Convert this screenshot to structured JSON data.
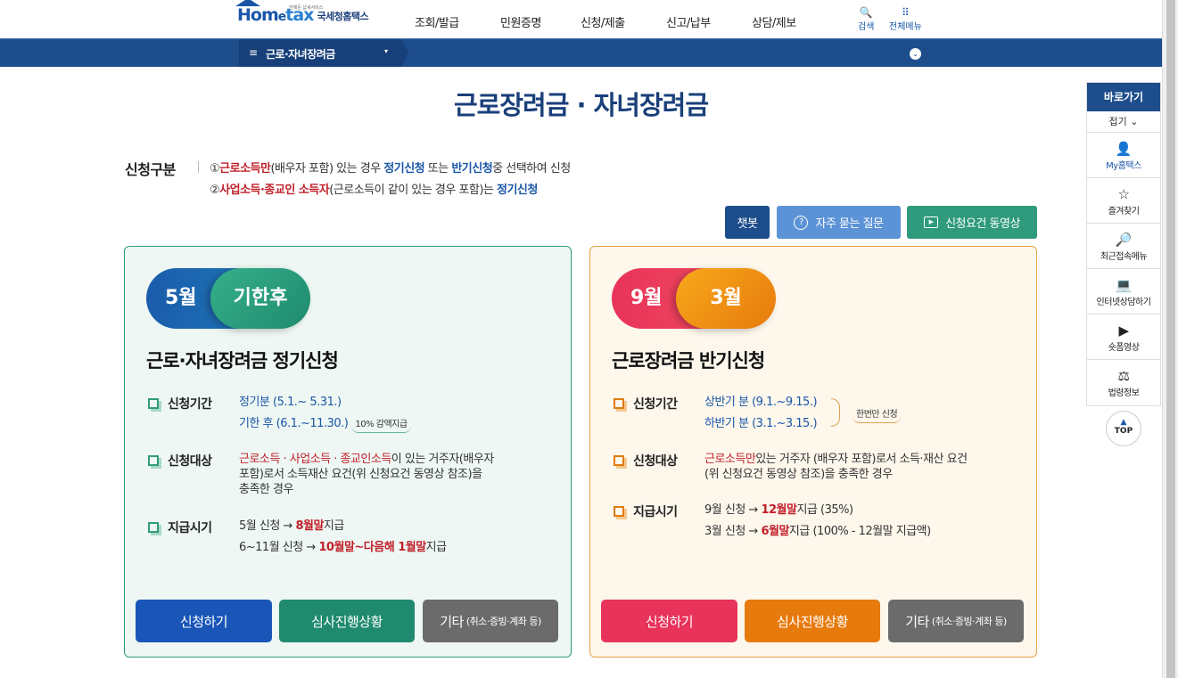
{
  "header": {
    "logo_text_home": "Hom",
    "logo_text_e": "e",
    "logo_text_tax": "tax",
    "logo_sub": "언제든 납세서비스",
    "logo_kr": "국세청홈택스",
    "gnb": [
      "조회/발급",
      "민원증명",
      "신청/제출",
      "신고/납부",
      "상담/제보"
    ],
    "search_label": "검색",
    "allmenu_label": "전체메뉴",
    "search_icon": "🔍",
    "allmenu_icon": "⠿"
  },
  "navbar": {
    "menu_icon": "≡",
    "selected": "근로·자녀장려금",
    "caret": "▾",
    "expand_icon": "⌄"
  },
  "page": {
    "title": "근로장려금 · 자녀장려금"
  },
  "apply": {
    "label": "신청구분",
    "line1": {
      "num": "①",
      "red": "근로소득만",
      "t1": "(배우자 포함) 있는 경우 ",
      "blue1": "정기신청",
      "t2": " 또는 ",
      "blue2": "반기신청",
      "t3": "중 선택하여 신청"
    },
    "line2": {
      "num": "②",
      "red": "사업소득·종교인 소득자",
      "t1": "(근로소득이 같이 있는 경우 포함)는 ",
      "blue": "정기신청"
    }
  },
  "top_buttons": {
    "chatbot": "챗봇",
    "faq": "자주 묻는 질문",
    "faq_icon": "?",
    "video": "신청요건 동영상",
    "video_icon": "▶"
  },
  "card_regular": {
    "pill_a": "5월",
    "pill_b": "기한후",
    "title": "근로·자녀장려금 정기신청",
    "period_label": "신청기간",
    "period_1": "정기분 (5.1.~ 5.31.)",
    "period_2": "기한 후 (6.1.~11.30.)",
    "period_2_note": "10% 감액지급",
    "target_label": "신청대상",
    "target_red": "근로소득 · 사업소득 · 종교인소득",
    "target_rest_1": "이 있는 거주자(배우자",
    "target_rest_2": "포함)로서 소득재산 요건(위 신청요건 동영상 참조)을",
    "target_rest_3": "충족한 경우",
    "pay_label": "지급시기",
    "pay_1_a": "5월 신청 → ",
    "pay_1_red": "8월말",
    "pay_1_b": "지급",
    "pay_2_a": "6~11월 신청 → ",
    "pay_2_red": "10월말~다음해 1월말",
    "pay_2_b": "지급",
    "btn_apply": "신청하기",
    "btn_status": "심사진행상황",
    "btn_etc": "기타",
    "btn_etc_small": "(취소·증빙·계좌 등)"
  },
  "card_half": {
    "pill_a": "9월",
    "pill_b": "3월",
    "title": "근로장려금 반기신청",
    "period_label": "신청기간",
    "period_1": "상반기 분 (9.1.~9.15.)",
    "period_2": "하반기 분 (3.1.~3.15.)",
    "period_note": "한번만 신청",
    "target_label": "신청대상",
    "target_red": "근로소득만",
    "target_rest_1": "있는 거주자 (배우자 포함)로서 소득·재산 요건",
    "target_rest_2": "(위 신청요건 동영상 참조)을 충족한 경우",
    "pay_label": "지급시기",
    "pay_1_a": "9월 신청 → ",
    "pay_1_red": "12월말",
    "pay_1_b": "지급 (35%)",
    "pay_2_a": "3월 신청 → ",
    "pay_2_red": "6월말",
    "pay_2_b": "지급 (100% - 12월말 지급액)",
    "btn_apply": "신청하기",
    "btn_status": "심사진행상황",
    "btn_etc": "기타",
    "btn_etc_small": "(취소·증빙·계좌 등)"
  },
  "quick": {
    "head": "바로가기",
    "fold": "접기 ⌄",
    "items": [
      {
        "icon": "👤",
        "label": "My홈택스"
      },
      {
        "icon": "☆",
        "label": "즐겨찾기"
      },
      {
        "icon": "🔎",
        "label": "최근접속메뉴"
      },
      {
        "icon": "💻",
        "label": "인터넷상담하기"
      },
      {
        "icon": "▶",
        "label": "숏폼영상"
      },
      {
        "icon": "⚖",
        "label": "법령정보"
      }
    ],
    "top_arrow": "▲",
    "top_label": "TOP"
  },
  "colors": {
    "navy": "#1d4d8b",
    "green": "#2f9a7c",
    "orange": "#e07a10",
    "red": "#c0202a"
  }
}
